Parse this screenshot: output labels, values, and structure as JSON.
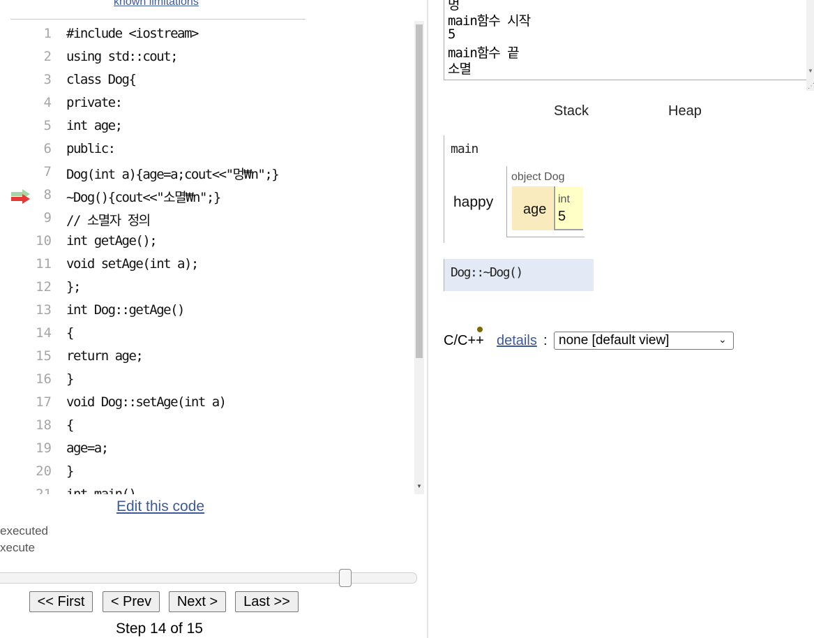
{
  "header": {
    "known_limitations_link": "known limitations"
  },
  "code": {
    "lines": [
      {
        "num": "1",
        "text": "#include <iostream>"
      },
      {
        "num": "2",
        "text": "using std::cout;"
      },
      {
        "num": "3",
        "text": "class Dog{"
      },
      {
        "num": "4",
        "text": "private:"
      },
      {
        "num": "5",
        "text": "int age;"
      },
      {
        "num": "6",
        "text": "public:"
      },
      {
        "num": "7",
        "text": "Dog(int a){age=a;cout<<\"멍₩n\";}"
      },
      {
        "num": "8",
        "text": "~Dog(){cout<<\"소멸₩n\";}"
      },
      {
        "num": "9",
        "text": "// 소멸자 정의"
      },
      {
        "num": "10",
        "text": "int getAge();"
      },
      {
        "num": "11",
        "text": "void setAge(int a);"
      },
      {
        "num": "12",
        "text": "};"
      },
      {
        "num": "13",
        "text": "int Dog::getAge()"
      },
      {
        "num": "14",
        "text": "{"
      },
      {
        "num": "15",
        "text": "return age;"
      },
      {
        "num": "16",
        "text": "}"
      },
      {
        "num": "17",
        "text": "void Dog::setAge(int a)"
      },
      {
        "num": "18",
        "text": "{"
      },
      {
        "num": "19",
        "text": "age=a;"
      },
      {
        "num": "20",
        "text": "}"
      },
      {
        "num": "21",
        "text": "int main()"
      }
    ],
    "prev_line_arrow_color": "#a5d6a7",
    "next_line_arrow_color": "#e53935"
  },
  "controls": {
    "edit_link": "Edit this code",
    "legend_executed": "executed",
    "legend_execute": "xecute",
    "first_label": "<< First",
    "prev_label": "< Prev",
    "next_label": "Next >",
    "last_label": "Last >>",
    "step_text": "Step 14 of 15",
    "step_current": 14,
    "step_total": 15
  },
  "output": {
    "lines": [
      "멍",
      "main함수 시작",
      "5",
      "main함수 끝",
      "소멸"
    ]
  },
  "visualization": {
    "stack_header": "Stack",
    "heap_header": "Heap",
    "frame_main_name": "main",
    "variable_name": "happy",
    "object_label": "object Dog",
    "field_name": "age",
    "field_type": "int",
    "field_value": "5",
    "frame_destructor_name": "Dog::~Dog()",
    "colors": {
      "field_name_bg": "#faebbf",
      "field_value_bg": "#ffffc6",
      "active_frame_bg": "#e3eaf5",
      "link": "#3c5a9a"
    }
  },
  "details": {
    "language_label": "C/C++",
    "details_link": "details",
    "colon": ":",
    "selected_view": "none [default view]"
  }
}
